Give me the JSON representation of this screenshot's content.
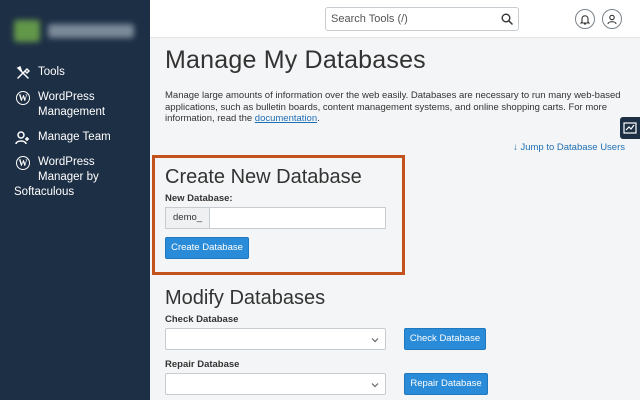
{
  "sidebar": {
    "items": [
      {
        "label": "Tools",
        "icon": "tools-icon"
      },
      {
        "label": "WordPress Management",
        "icon": "wordpress-icon"
      },
      {
        "label": "Manage Team",
        "icon": "team-icon"
      },
      {
        "label": "WordPress Manager by",
        "label_extra": "Softaculous",
        "icon": "wordpress-icon"
      }
    ]
  },
  "topbar": {
    "search_placeholder": "Search Tools (/)",
    "notifications_icon": "bell-icon",
    "user_icon": "user-icon"
  },
  "main": {
    "title": "Manage My Databases",
    "description": "Manage large amounts of information over the web easily. Databases are necessary to run many web-based applications, such as bulletin boards, content management systems, and online shopping carts. For more information, read the ",
    "doc_link": "documentation",
    "description_end": ".",
    "jump_link": "Jump to Database Users",
    "create": {
      "heading": "Create New Database",
      "label": "New Database:",
      "prefix": "demo_",
      "value": "",
      "button": "Create Database"
    },
    "modify": {
      "heading": "Modify Databases",
      "check_label": "Check Database",
      "check_button": "Check Database",
      "repair_label": "Repair Database",
      "repair_button": "Repair Database"
    }
  },
  "colors": {
    "sidebar": "#1d2f45",
    "accent": "#2a8bd8",
    "highlight": "#c4521c",
    "link": "#1f6fb5"
  }
}
